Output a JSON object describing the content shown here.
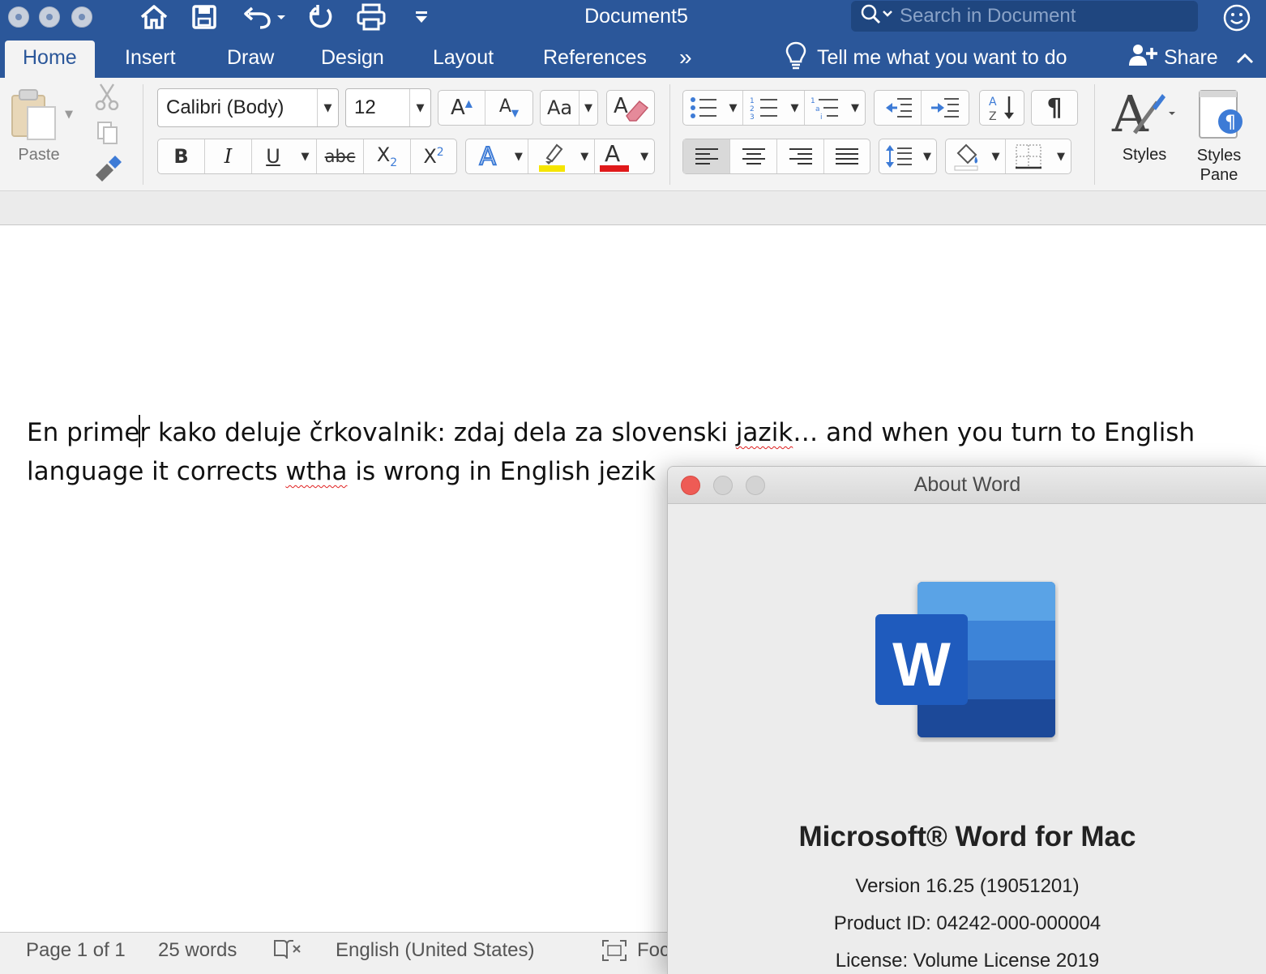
{
  "window": {
    "title": "Document5",
    "search_placeholder": "Search in Document"
  },
  "tabs": [
    {
      "label": "Home",
      "active": true
    },
    {
      "label": "Insert"
    },
    {
      "label": "Draw"
    },
    {
      "label": "Design"
    },
    {
      "label": "Layout"
    },
    {
      "label": "References"
    }
  ],
  "tabs_overflow": "»",
  "tell_me": "Tell me what you want to do",
  "share": "Share",
  "ribbon": {
    "paste": "Paste",
    "font_name": "Calibri (Body)",
    "font_size": "12",
    "bold": "B",
    "italic": "I",
    "underline": "U",
    "strikethrough": "abc",
    "styles": "Styles",
    "styles_pane_1": "Styles",
    "styles_pane_2": "Pane",
    "highlight_color": "#f5e500",
    "font_color": "#e0191a"
  },
  "document": {
    "line1_a": "En prime",
    "line1_b": "r kako deluje črkovalnik: zdaj dela za slovenski ",
    "line1_err": "jazik",
    "line1_c": "… and when you turn to English",
    "line2_a": "language it corrects ",
    "line2_err": "wtha",
    "line2_b": " is wrong in English jezik"
  },
  "status": {
    "page": "Page 1 of 1",
    "words": "25 words",
    "language": "English (United States)",
    "focus": "Foc"
  },
  "about": {
    "title": "About Word",
    "logo_letter": "W",
    "product": "Microsoft® Word for Mac",
    "version": "Version 16.25 (19051201)",
    "product_id": "Product ID: 04242-000-000004",
    "license": "License: Volume License 2019"
  },
  "colors": {
    "word_blue": "#2b579a",
    "spell_error": "#e02020"
  }
}
